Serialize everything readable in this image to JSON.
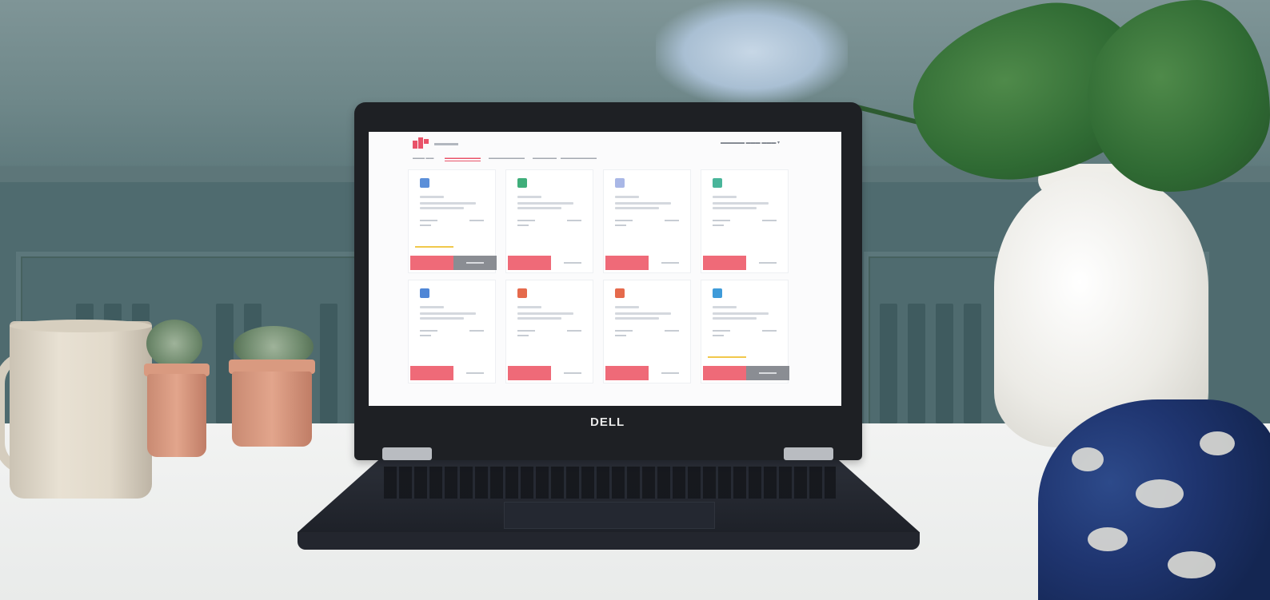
{
  "laptop": {
    "brand_logo": "DELL"
  },
  "screen_app": {
    "cards_row1": [
      {
        "icon_color": "#5b8fd9",
        "has_progress": true,
        "secondary_filled": true
      },
      {
        "icon_color": "#3fae7a",
        "has_progress": false,
        "secondary_filled": false
      },
      {
        "icon_color": "#a9b7e6",
        "has_progress": false,
        "secondary_filled": false
      },
      {
        "icon_color": "#49b59a",
        "has_progress": false,
        "secondary_filled": false
      }
    ],
    "cards_row2": [
      {
        "icon_color": "#4f86d6",
        "has_progress": false,
        "secondary_filled": false
      },
      {
        "icon_color": "#e56a4c",
        "has_progress": false,
        "secondary_filled": false
      },
      {
        "icon_color": "#e56a4c",
        "has_progress": false,
        "secondary_filled": false
      },
      {
        "icon_color": "#3f9bd9",
        "has_progress": true,
        "secondary_filled": true
      }
    ],
    "accent_color": "#ef6a78",
    "progress_color": "#f1c84b"
  },
  "scene_colors": {
    "wall": "#6e8789",
    "wainscot": "#4f6b6f",
    "table": "#eef0ef",
    "vase": "#efeee9",
    "blanket": "#1f3570"
  }
}
